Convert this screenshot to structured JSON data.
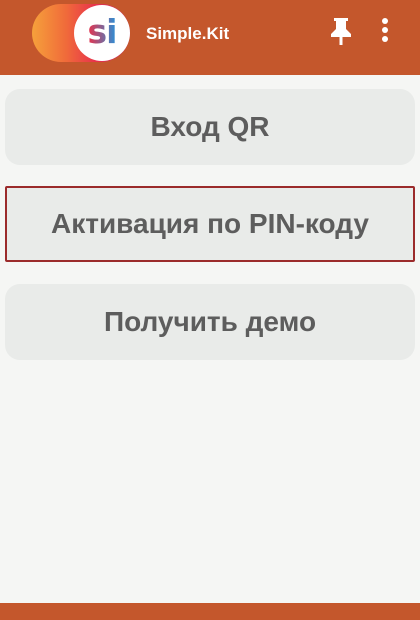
{
  "app": {
    "logo_text": "si",
    "title": "Simple.Kit"
  },
  "toolbar": {
    "pin_icon": "pin-icon",
    "menu_icon": "more-vert-icon"
  },
  "buttons": {
    "qr_login": "Вход QR",
    "pin_activation": "Активация по PIN-коду",
    "get_demo": "Получить демо"
  },
  "colors": {
    "appbar": "#c4572c",
    "button_bg": "#e9ebe9",
    "button_text": "#5d5d5d",
    "focus_border": "#9b2b2b",
    "page_bg": "#f5f6f4"
  }
}
